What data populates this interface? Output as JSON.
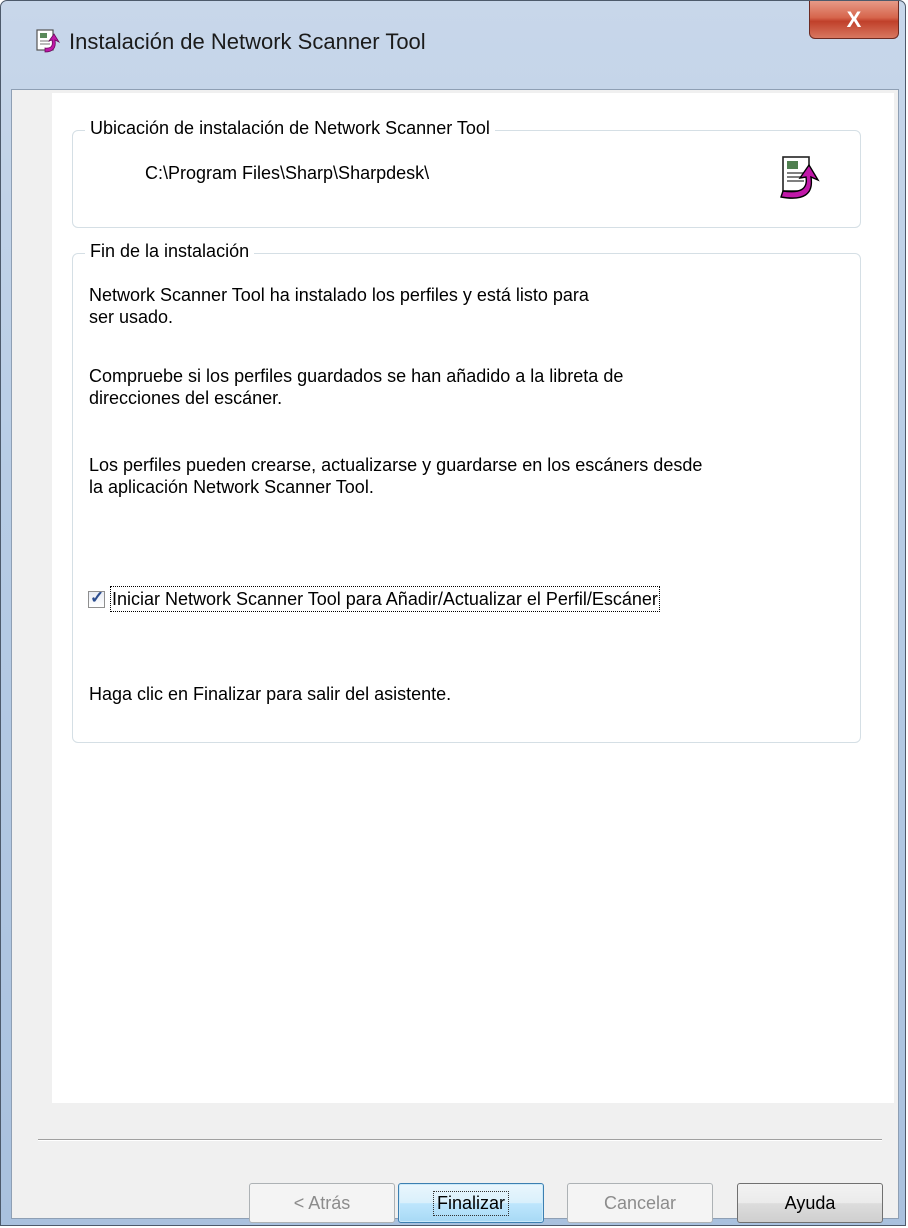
{
  "window": {
    "title": "Instalación de Network Scanner Tool",
    "close_label": "X"
  },
  "location_group": {
    "legend": "Ubicación de instalación de Network Scanner Tool",
    "path": "C:\\Program Files\\Sharp\\Sharpdesk\\"
  },
  "finish_group": {
    "legend": "Fin de la instalación",
    "para1_line1": "Network Scanner Tool ha instalado los perfiles y está listo para",
    "para1_line2": "ser usado.",
    "para2_line1": "Compruebe si los perfiles guardados se han añadido a la libreta de",
    "para2_line2": "direcciones del escáner.",
    "para3_line1": "Los perfiles pueden crearse, actualizarse y guardarse en los escáners desde",
    "para3_line2": "la aplicación Network Scanner Tool.",
    "checkbox_label": "Iniciar Network Scanner Tool para Añadir/Actualizar el Perfil/Escáner",
    "checkbox_checked": true,
    "final_note": "Haga clic en Finalizar para salir del asistente."
  },
  "buttons": {
    "back": "< Atrás",
    "finish": "Finalizar",
    "cancel": "Cancelar",
    "help": "Ayuda"
  },
  "colors": {
    "accent_arrow": "#c018a8",
    "close_red": "#c0402a"
  }
}
